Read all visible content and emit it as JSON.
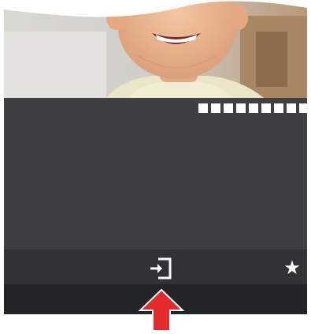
{
  "image": {
    "subject": "smiling-child-photo"
  },
  "pagination": {
    "total": 9,
    "dot_color": "#ffffff"
  },
  "toolbar": {
    "login_icon": "login-icon",
    "favorite_icon": "star-icon",
    "favorite_glyph": "★"
  },
  "annotation": {
    "icon": "red-up-arrow",
    "color": "#e32b2b"
  },
  "colors": {
    "content_bg": "#3f4042",
    "toolbar_bg": "#313234",
    "strip_bg": "#232426"
  }
}
